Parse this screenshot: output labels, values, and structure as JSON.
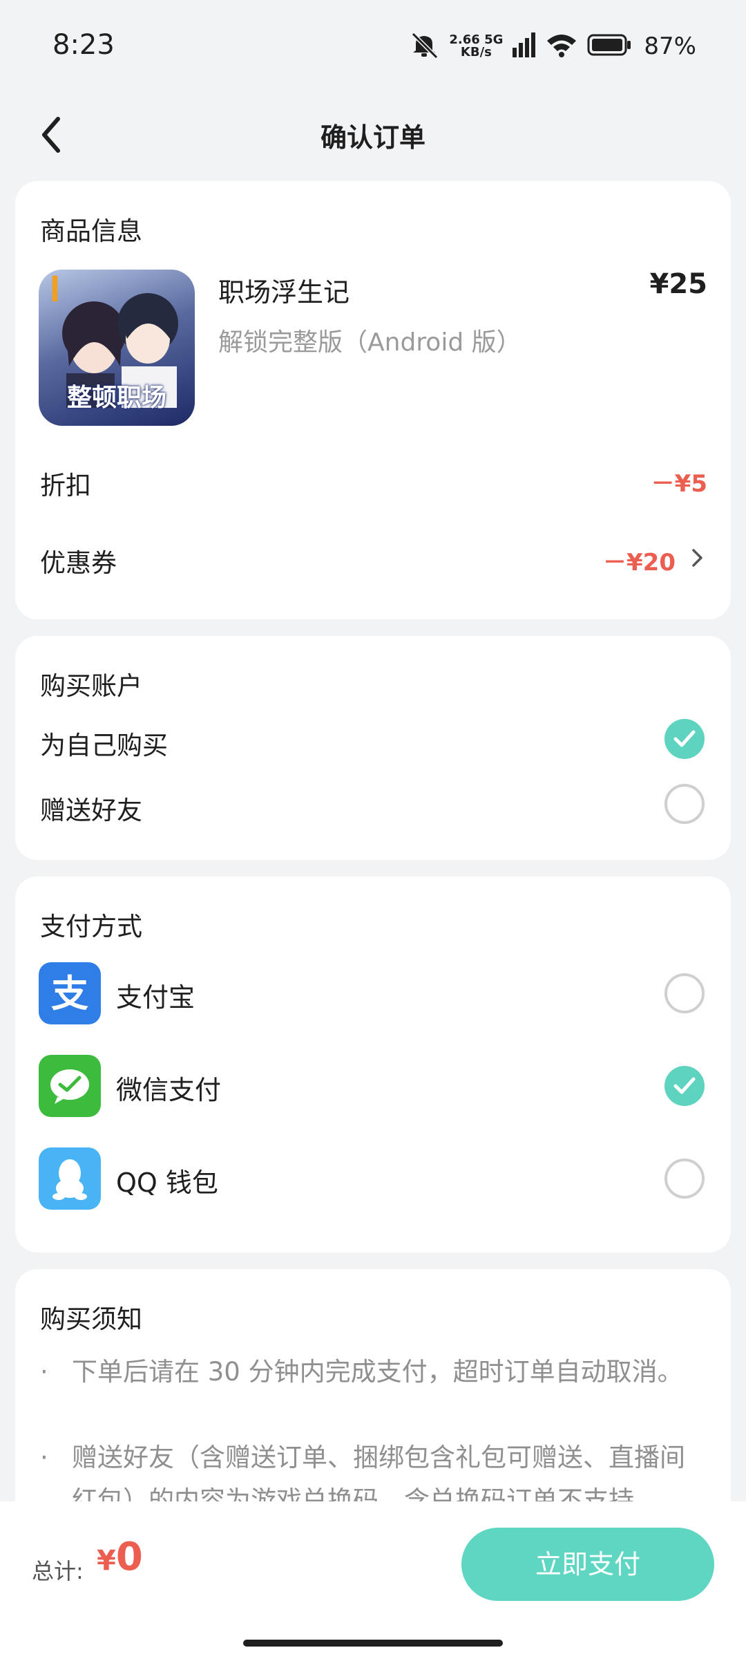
{
  "status_bar": {
    "time": "8:23",
    "net_speed": "2.66",
    "net_unit": "KB/s",
    "net_type": "5G",
    "battery": "87%"
  },
  "header": {
    "title": "确认订单"
  },
  "product_card": {
    "title": "商品信息",
    "name": "职场浮生记",
    "subtitle": "解锁完整版（Android 版）",
    "price": "¥25",
    "thumb_caption": "整顿职场",
    "discount_label": "折扣",
    "discount_value": "－¥5",
    "coupon_label": "优惠券",
    "coupon_value": "－¥20"
  },
  "account_card": {
    "title": "购买账户",
    "options": [
      {
        "label": "为自己购买",
        "checked": true
      },
      {
        "label": "赠送好友",
        "checked": false
      }
    ]
  },
  "payment_card": {
    "title": "支付方式",
    "methods": [
      {
        "label": "支付宝",
        "icon": "alipay-icon",
        "color": "#2f7ee7",
        "checked": false
      },
      {
        "label": "微信支付",
        "icon": "wechat-pay-icon",
        "color": "#3dbb3c",
        "checked": true
      },
      {
        "label": "QQ 钱包",
        "icon": "qq-wallet-icon",
        "color": "#48b3f5",
        "checked": false
      }
    ]
  },
  "notice_card": {
    "title": "购买须知",
    "items": [
      "下单后请在 30 分钟内完成支付，超时订单自动取消。",
      "赠送好友（含赠送订单、捆绑包含礼包可赠送、直播间红包）的内容为游戏兑换码，含兑换码订单不支持"
    ]
  },
  "bottom_bar": {
    "total_label": "总计:",
    "currency": "¥",
    "total": "0",
    "pay_button": "立即支付"
  },
  "colors": {
    "accent": "#5fd6c2",
    "price_red": "#ec5e4f"
  }
}
